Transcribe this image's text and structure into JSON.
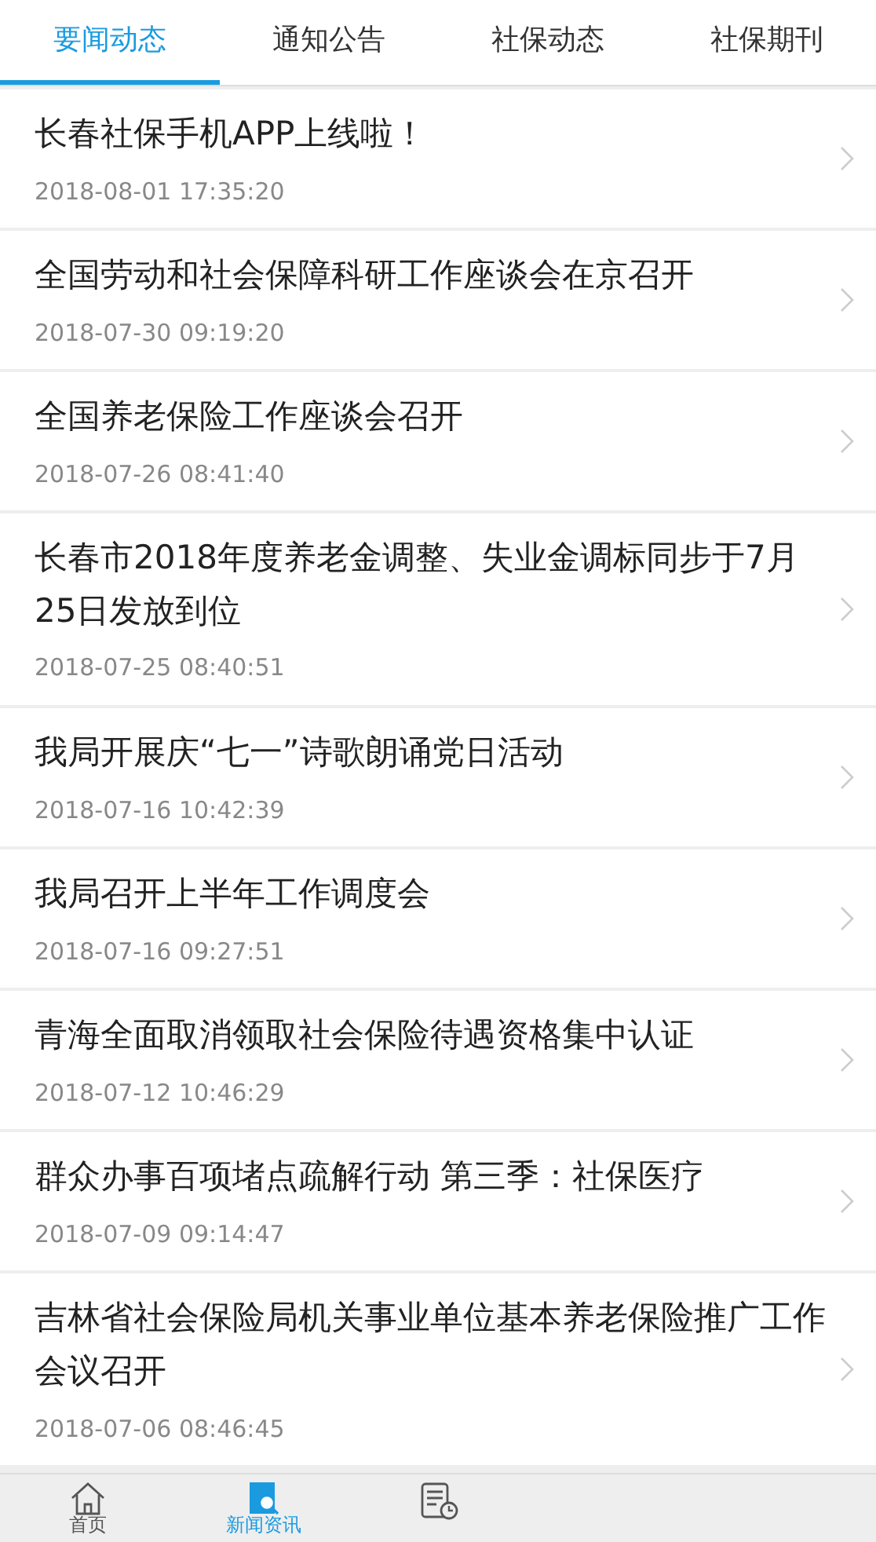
{
  "tabs": [
    {
      "label": "要闻动态",
      "selected": true
    },
    {
      "label": "通知公告",
      "selected": false
    },
    {
      "label": "社保动态",
      "selected": false
    },
    {
      "label": "社保期刊",
      "selected": false
    }
  ],
  "news": [
    {
      "title": "长春社保手机APP上线啦！",
      "time": "2018-08-01 17:35:20"
    },
    {
      "title": "全国劳动和社会保障科研工作座谈会在京召开",
      "time": "2018-07-30 09:19:20"
    },
    {
      "title": "全国养老保险工作座谈会召开",
      "time": "2018-07-26 08:41:40"
    },
    {
      "title": "长春市2018年度养老金调整、失业金调标同步于7月25日发放到位",
      "time": "2018-07-25 08:40:51"
    },
    {
      "title": "我局开展庆“七一”诗歌朗诵党日活动",
      "time": "2018-07-16 10:42:39"
    },
    {
      "title": "我局召开上半年工作调度会",
      "time": "2018-07-16 09:27:51"
    },
    {
      "title": "青海全面取消领取社会保险待遇资格集中认证",
      "time": "2018-07-12 10:46:29"
    },
    {
      "title": "群众办事百项堵点疏解行动 第三季：社保医疗",
      "time": "2018-07-09 09:14:47"
    },
    {
      "title": "吉林省社会保险局机关事业单位基本养老保险推广工作会议召开",
      "time": "2018-07-06 08:46:45"
    }
  ],
  "bottom_nav": [
    {
      "kind": "home",
      "label": "首页",
      "selected": false
    },
    {
      "kind": "news",
      "label": "新闻资讯",
      "selected": true
    },
    {
      "kind": "records",
      "selected": false
    }
  ]
}
